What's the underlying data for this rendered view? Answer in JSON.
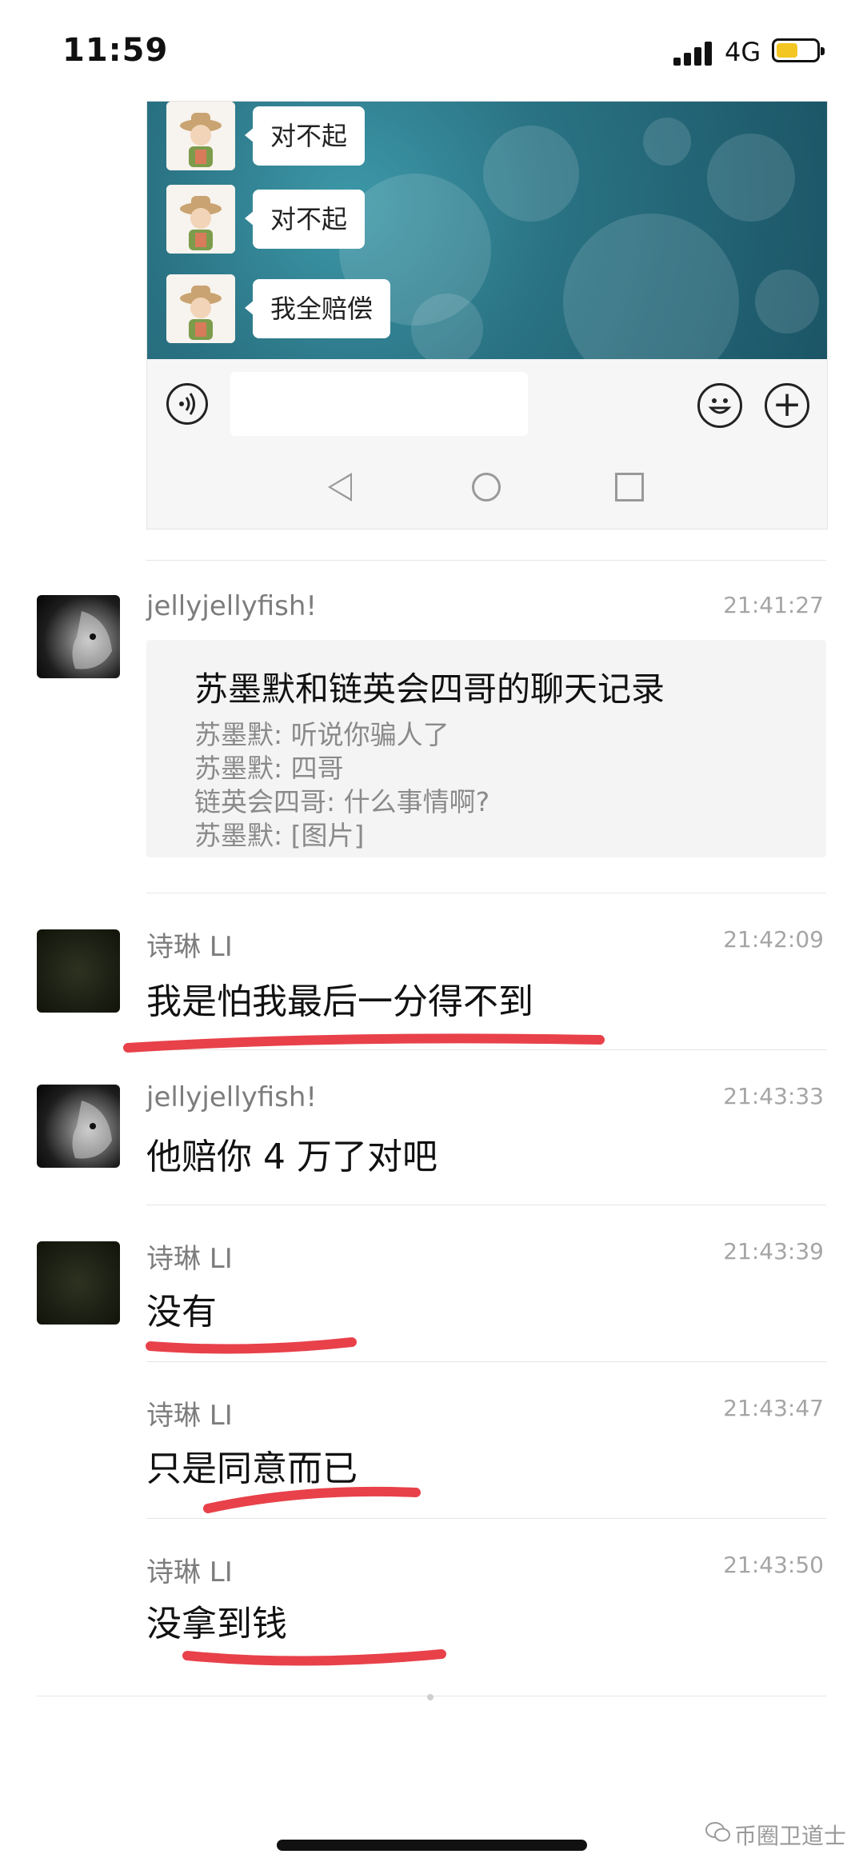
{
  "status_bar": {
    "time": "11:59",
    "network": "4G",
    "battery_color": "#f3c623"
  },
  "embedded_chat": {
    "bubbles": [
      "对不起",
      "对不起",
      "我全赔偿"
    ]
  },
  "messages": [
    {
      "sender": "jellyjellyfish!",
      "time": "21:41:27",
      "avatar": "lion-avatar",
      "card": {
        "title": "苏墨默和链英会四哥的聊天记录",
        "lines": [
          "苏墨默: 听说你骗人了",
          "苏墨默: 四哥",
          "链英会四哥: 什么事情啊?",
          "苏墨默: [图片]"
        ]
      }
    },
    {
      "sender": "诗琳 LI",
      "time": "21:42:09",
      "text": "我是怕我最后一分得不到",
      "avatar": "dark-avatar"
    },
    {
      "sender": "jellyjellyfish!",
      "time": "21:43:33",
      "text": "他赔你 4 万了对吧",
      "avatar": "lion-avatar"
    },
    {
      "sender": "诗琳 LI",
      "time": "21:43:39",
      "text": "没有",
      "avatar": "dark-avatar"
    },
    {
      "sender": "诗琳 LI",
      "time": "21:43:47",
      "text": "只是同意而已"
    },
    {
      "sender": "诗琳 LI",
      "time": "21:43:50",
      "text": "没拿到钱"
    }
  ],
  "watermark": {
    "text": "币圈卫道士",
    "icon": "wechat-icon"
  },
  "colors": {
    "underline": "#e8414a",
    "accent_yellow": "#f3c623"
  }
}
